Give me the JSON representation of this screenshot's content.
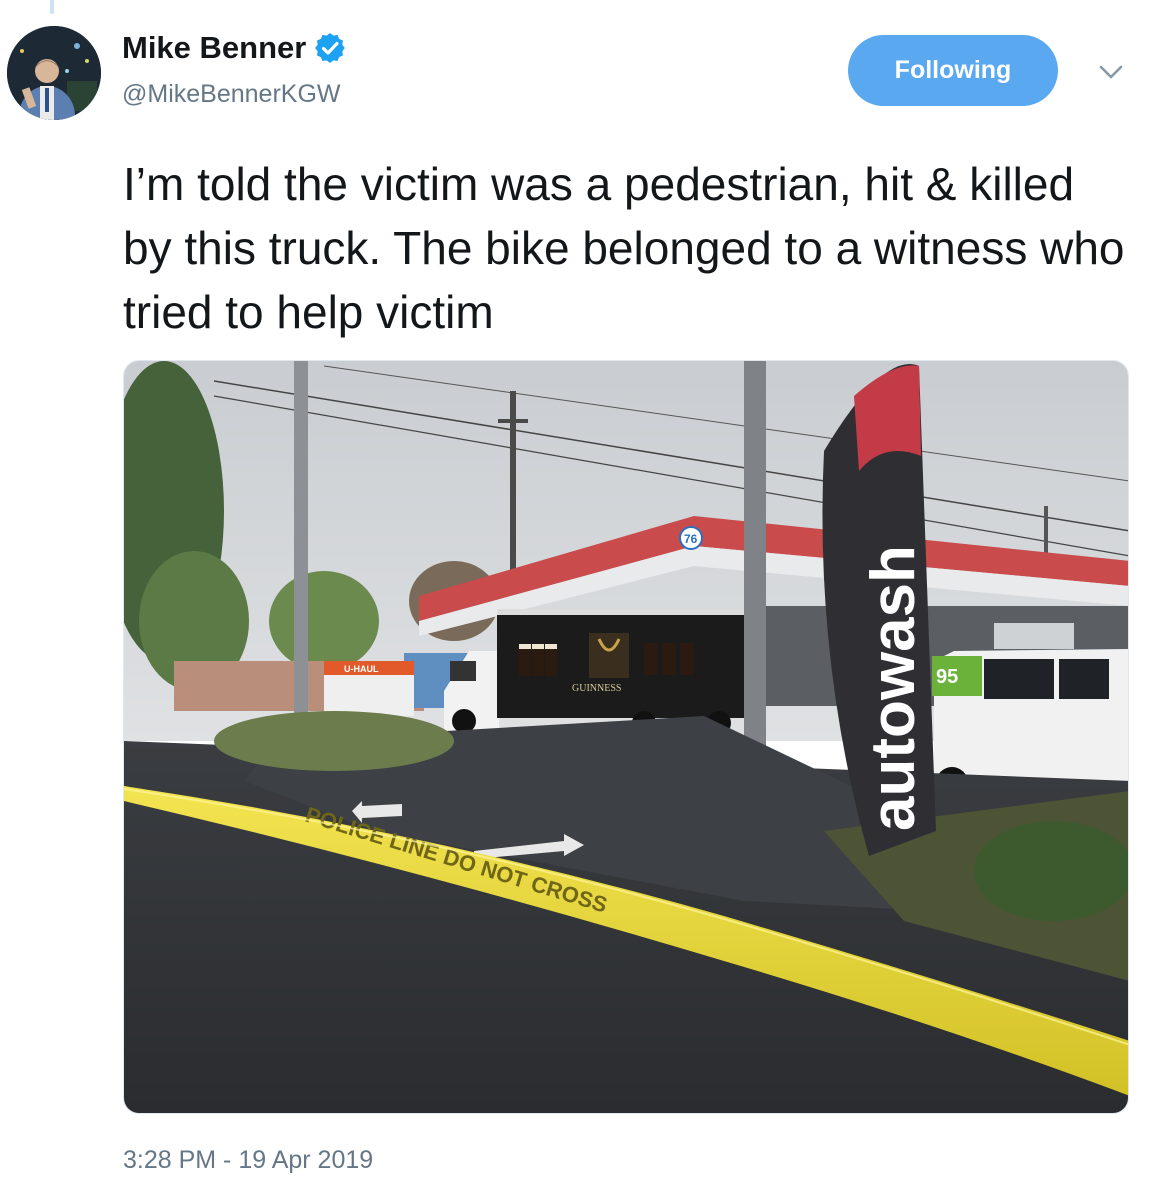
{
  "author": {
    "display_name": "Mike Benner",
    "handle": "@MikeBennerKGW",
    "verified": true,
    "avatar_icon": "profile-photo"
  },
  "actions": {
    "follow_label": "Following",
    "menu_icon": "chevron-down-icon"
  },
  "tweet": {
    "text": "I’m told the victim was a pedestrian, hit & killed by this truck. The bike belonged to a witness who tried to help victim",
    "timestamp": "3:28 PM - 19 Apr 2019"
  },
  "media": {
    "description_icon": "photo-gas-station-scene",
    "truck_brand": "GUINNESS",
    "banner_text": "autowash",
    "station_logo": "76",
    "van_logo": "95",
    "uhaul_text": "U-HAUL",
    "tape_text": "POLICE LINE DO NOT CROSS"
  },
  "colors": {
    "accent": "#1da1f2",
    "button": "#5aa8ef",
    "secondary_text": "#657786",
    "primary_text": "#14171a"
  }
}
